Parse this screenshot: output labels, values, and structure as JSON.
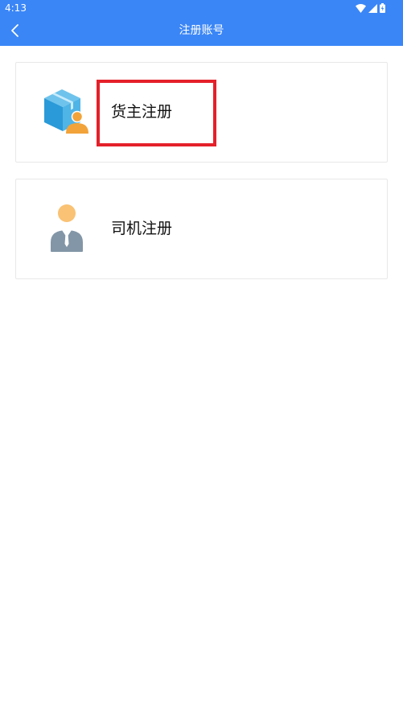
{
  "status_bar": {
    "time": "4:13"
  },
  "header": {
    "title": "注册账号",
    "back_icon": "chevron-left-icon",
    "background_color": "#3a86f7"
  },
  "options": [
    {
      "label": "货主注册",
      "icon": "cargo-owner-icon",
      "highlighted": true
    },
    {
      "label": "司机注册",
      "icon": "driver-icon",
      "highlighted": false
    }
  ],
  "highlight_color": "#e4202a"
}
